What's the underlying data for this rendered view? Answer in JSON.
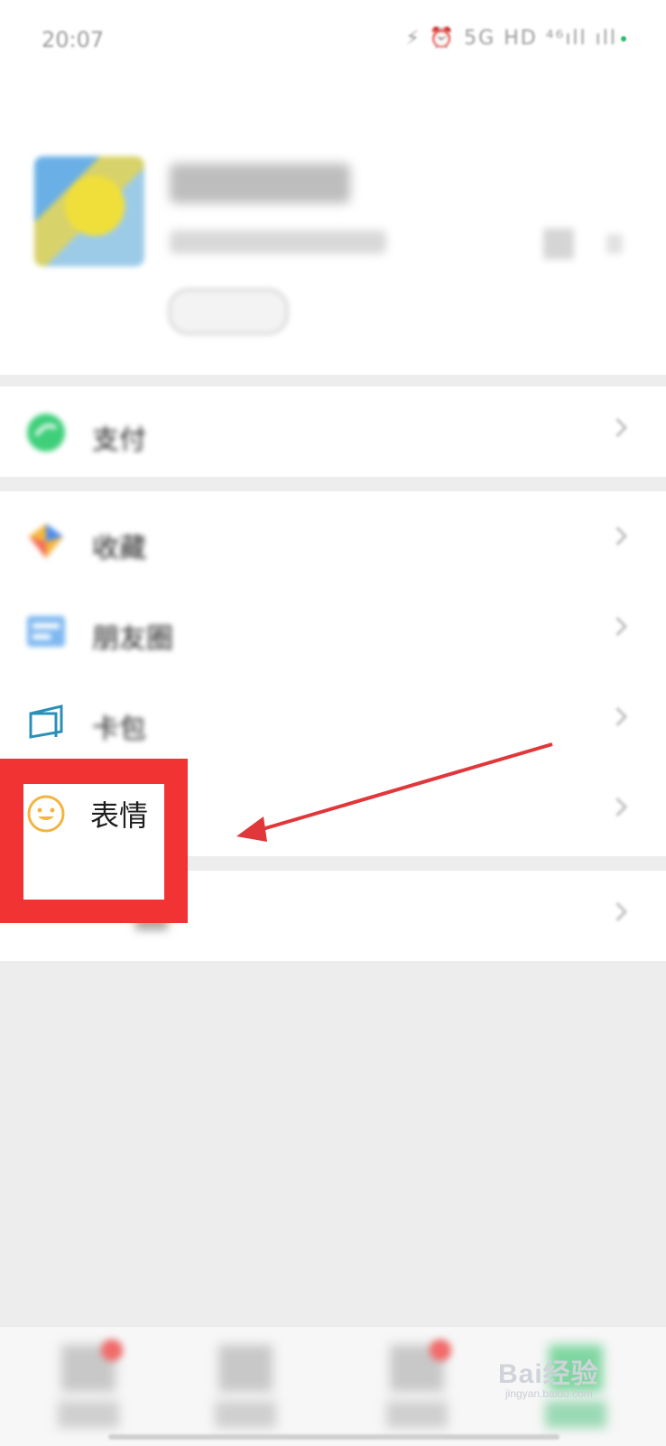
{
  "status_bar": {
    "time": "20:07",
    "indicators": "⚡ ⏰ 5G HD ⁴⁶ıll ıll"
  },
  "menu": {
    "pay": {
      "label": "支付",
      "icon": "pay-icon"
    },
    "favorites": {
      "label": "收藏",
      "icon": "favorites-icon"
    },
    "moments": {
      "label": "朋友圈",
      "icon": "moments-icon"
    },
    "cards": {
      "label": "卡包",
      "icon": "card-wallet-icon"
    },
    "stickers": {
      "label": "表情",
      "icon": "smiley-face-icon"
    },
    "settings": {
      "label": "设置",
      "icon": "settings-icon"
    }
  },
  "annotation": {
    "highlight_color": "#f23333",
    "arrow_color": "#e0373a"
  },
  "watermark": {
    "brand": "Bai经验",
    "url": "jingyan.baidu.com"
  },
  "colors": {
    "accent_green": "#2bbf6a",
    "background": "#ededed",
    "card": "#ffffff"
  }
}
